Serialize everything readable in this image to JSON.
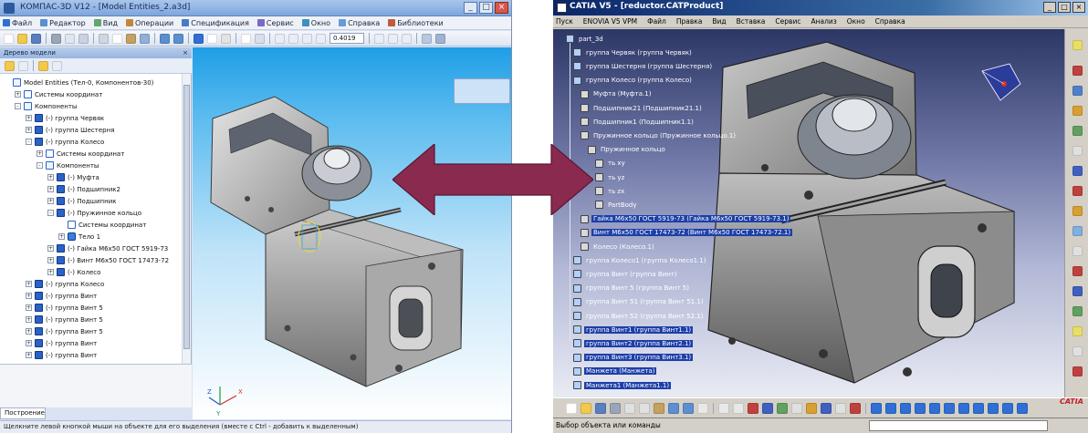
{
  "kompas": {
    "title": "КОМПАС-3D V12 - [Model Entities_2.a3d]",
    "menu": [
      "Файл",
      "Редактор",
      "Вид",
      "Операции",
      "Спецификация",
      "Сервис",
      "Окно",
      "Справка",
      "Библиотеки"
    ],
    "zoom_value": "0.4019",
    "tree_panel_title": "Дерево модели",
    "tree": [
      {
        "label": "Model Entities (Тел-0, Компонентов-30)",
        "level": 0,
        "exp": "",
        "icon": "comp"
      },
      {
        "label": "Системы координат",
        "level": 1,
        "exp": "+",
        "icon": "axes"
      },
      {
        "label": "Компоненты",
        "level": 1,
        "exp": "-",
        "icon": "comp"
      },
      {
        "label": "(-) группа Червяк",
        "level": 2,
        "exp": "+",
        "icon": "part"
      },
      {
        "label": "(-) группа Шестерня",
        "level": 2,
        "exp": "+",
        "icon": "part"
      },
      {
        "label": "(-) группа Колесо",
        "level": 2,
        "exp": "-",
        "icon": "part"
      },
      {
        "label": "Системы координат",
        "level": 3,
        "exp": "+",
        "icon": "axes"
      },
      {
        "label": "Компоненты",
        "level": 3,
        "exp": "-",
        "icon": "comp"
      },
      {
        "label": "(-) Муфта",
        "level": 4,
        "exp": "+",
        "icon": "part"
      },
      {
        "label": "(-) Подшипник2",
        "level": 4,
        "exp": "+",
        "icon": "part"
      },
      {
        "label": "(-) Подшипник",
        "level": 4,
        "exp": "+",
        "icon": "part"
      },
      {
        "label": "(-) Пружинное кольцо",
        "level": 4,
        "exp": "-",
        "icon": "part"
      },
      {
        "label": "Системы координат",
        "level": 5,
        "exp": "",
        "icon": "axes"
      },
      {
        "label": "Тело 1",
        "level": 5,
        "exp": "+",
        "icon": "body"
      },
      {
        "label": "(-) Гайка М6х50 ГОСТ 5919-73",
        "level": 4,
        "exp": "+",
        "icon": "part"
      },
      {
        "label": "(-) Винт М6х50 ГОСТ 17473-72",
        "level": 4,
        "exp": "+",
        "icon": "part"
      },
      {
        "label": "(-) Колесо",
        "level": 4,
        "exp": "+",
        "icon": "part"
      },
      {
        "label": "(-) группа Колесо",
        "level": 2,
        "exp": "+",
        "icon": "part"
      },
      {
        "label": "(-) группа Винт",
        "level": 2,
        "exp": "+",
        "icon": "part"
      },
      {
        "label": "(-) группа Винт 5",
        "level": 2,
        "exp": "+",
        "icon": "part"
      },
      {
        "label": "(-) группа Винт 5",
        "level": 2,
        "exp": "+",
        "icon": "part"
      },
      {
        "label": "(-) группа Винт 5",
        "level": 2,
        "exp": "+",
        "icon": "part"
      },
      {
        "label": "(-) группа Винт",
        "level": 2,
        "exp": "+",
        "icon": "part"
      },
      {
        "label": "(-) группа Винт",
        "level": 2,
        "exp": "+",
        "icon": "part"
      }
    ],
    "tab_label": "Построение",
    "status": "Щелкните левой кнопкой мыши на объекте для его выделения (вместе с Ctrl - добавить к выделенным)"
  },
  "catia": {
    "title": "CATIA V5 - [reductor.CATProduct]",
    "menu": [
      "Пуск",
      "ENOVIA V5 VPM",
      "Файл",
      "Правка",
      "Вид",
      "Вставка",
      "Сервис",
      "Анализ",
      "Окно",
      "Справка"
    ],
    "tree": [
      {
        "label": "part_3d",
        "level": 0,
        "sel": false
      },
      {
        "label": "группа Червяк (группа Червяк)",
        "level": 1,
        "sel": false
      },
      {
        "label": "группа Шестерня (группа Шестерня)",
        "level": 1,
        "sel": false
      },
      {
        "label": "группа Колесо (группа Колесо)",
        "level": 1,
        "sel": false
      },
      {
        "label": "Муфта (Муфта.1)",
        "level": 2,
        "sel": false
      },
      {
        "label": "Подшипник21 (Подшипник21.1)",
        "level": 2,
        "sel": false
      },
      {
        "label": "Подшипник1 (Подшипник1.1)",
        "level": 2,
        "sel": false
      },
      {
        "label": "Пружинное кольцо (Пружинное кольцо.1)",
        "level": 2,
        "sel": false
      },
      {
        "label": "Пружинное кольцо",
        "level": 3,
        "sel": false
      },
      {
        "label": "ть xy",
        "level": 4,
        "sel": false
      },
      {
        "label": "ть yz",
        "level": 4,
        "sel": false
      },
      {
        "label": "ть zx",
        "level": 4,
        "sel": false
      },
      {
        "label": "PartBody",
        "level": 4,
        "sel": false
      },
      {
        "label": "Гайка М6х50 ГОСТ 5919-73 (Гайка М6х50 ГОСТ 5919-73.1)",
        "level": 2,
        "sel": true
      },
      {
        "label": "Винт М6х50 ГОСТ 17473-72 (Винт М6х50 ГОСТ 17473-72.1)",
        "level": 2,
        "sel": true
      },
      {
        "label": "Колесо (Колесо.1)",
        "level": 2,
        "sel": false
      },
      {
        "label": "группа Колесо1 (группа Колесо1.1)",
        "level": 1,
        "sel": false
      },
      {
        "label": "группа Винт (группа Винт)",
        "level": 1,
        "sel": false
      },
      {
        "label": "группа Винт 5 (группа Винт 5)",
        "level": 1,
        "sel": false
      },
      {
        "label": "группа Винт 51 (группа Винт 51.1)",
        "level": 1,
        "sel": false
      },
      {
        "label": "группа Винт 52 (группа Винт 52.1)",
        "level": 1,
        "sel": false
      },
      {
        "label": "группа Винт1 (группа Винт1.1)",
        "level": 1,
        "sel": true
      },
      {
        "label": "группа Винт2 (группа Винт2.1)",
        "level": 1,
        "sel": true
      },
      {
        "label": "группа Винт3 (группа Винт3.1)",
        "level": 1,
        "sel": true
      },
      {
        "label": "Манжета (Манжета)",
        "level": 1,
        "sel": true
      },
      {
        "label": "Манжета1 (Манжета1.1)",
        "level": 1,
        "sel": true
      }
    ],
    "status": "Выбор объекта или команды",
    "logo": "CATIA"
  },
  "colors": {
    "arrow": "#8a2a4e",
    "catia_selection": "#1d3fa8",
    "kompas_sky": "#1f9ee6"
  },
  "icons": [
    "app-icon",
    "minimize-icon",
    "maximize-icon",
    "close-icon",
    "tree-part-icon",
    "coordinate-system-icon",
    "body-icon",
    "compass-icon",
    "double-arrow-icon"
  ]
}
